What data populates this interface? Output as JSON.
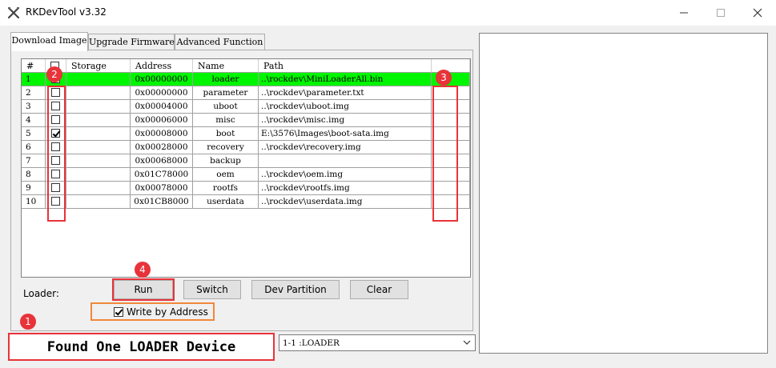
{
  "window": {
    "title": "RKDevTool v3.32",
    "controls": [
      "minimize",
      "maximize",
      "close"
    ]
  },
  "tabs": [
    {
      "label": "Download Image",
      "active": true
    },
    {
      "label": "Upgrade Firmware",
      "active": false
    },
    {
      "label": "Advanced Function",
      "active": false
    }
  ],
  "table": {
    "headers": {
      "num": "#",
      "storage": "Storage",
      "address": "Address",
      "name": "Name",
      "path": "Path"
    },
    "rows": [
      {
        "num": "1",
        "checked": false,
        "storage": "",
        "address": "0x00000000",
        "name": "loader",
        "path": "..\\rockdev\\MiniLoaderAll.bin",
        "highlight": true
      },
      {
        "num": "2",
        "checked": false,
        "storage": "",
        "address": "0x00000000",
        "name": "parameter",
        "path": "..\\rockdev\\parameter.txt",
        "highlight": false
      },
      {
        "num": "3",
        "checked": false,
        "storage": "",
        "address": "0x00004000",
        "name": "uboot",
        "path": "..\\rockdev\\uboot.img",
        "highlight": false
      },
      {
        "num": "4",
        "checked": false,
        "storage": "",
        "address": "0x00006000",
        "name": "misc",
        "path": "..\\rockdev\\misc.img",
        "highlight": false
      },
      {
        "num": "5",
        "checked": true,
        "storage": "",
        "address": "0x00008000",
        "name": "boot",
        "path": "E:\\3576\\Images\\boot-sata.img",
        "highlight": false
      },
      {
        "num": "6",
        "checked": false,
        "storage": "",
        "address": "0x00028000",
        "name": "recovery",
        "path": "..\\rockdev\\recovery.img",
        "highlight": false
      },
      {
        "num": "7",
        "checked": false,
        "storage": "",
        "address": "0x00068000",
        "name": "backup",
        "path": "",
        "highlight": false
      },
      {
        "num": "8",
        "checked": false,
        "storage": "",
        "address": "0x01C78000",
        "name": "oem",
        "path": "..\\rockdev\\oem.img",
        "highlight": false
      },
      {
        "num": "9",
        "checked": false,
        "storage": "",
        "address": "0x00078000",
        "name": "rootfs",
        "path": "..\\rockdev\\rootfs.img",
        "highlight": false
      },
      {
        "num": "10",
        "checked": false,
        "storage": "",
        "address": "0x01CB8000",
        "name": "userdata",
        "path": "..\\rockdev\\userdata.img",
        "highlight": false
      }
    ]
  },
  "loader_label": "Loader:",
  "buttons": {
    "run": "Run",
    "switch": "Switch",
    "dev_partition": "Dev Partition",
    "clear": "Clear"
  },
  "write_by_address": {
    "label": "Write by Address",
    "checked": true
  },
  "status_text": "Found One LOADER Device",
  "device_select": {
    "value": "1-1 :LOADER"
  },
  "annotations": {
    "badge1": "1",
    "badge2": "2",
    "badge3": "3",
    "badge4": "4"
  },
  "colors": {
    "highlight_row": "#00f500",
    "annotation_red": "#e8333a",
    "annotation_orange": "#f0883a"
  }
}
